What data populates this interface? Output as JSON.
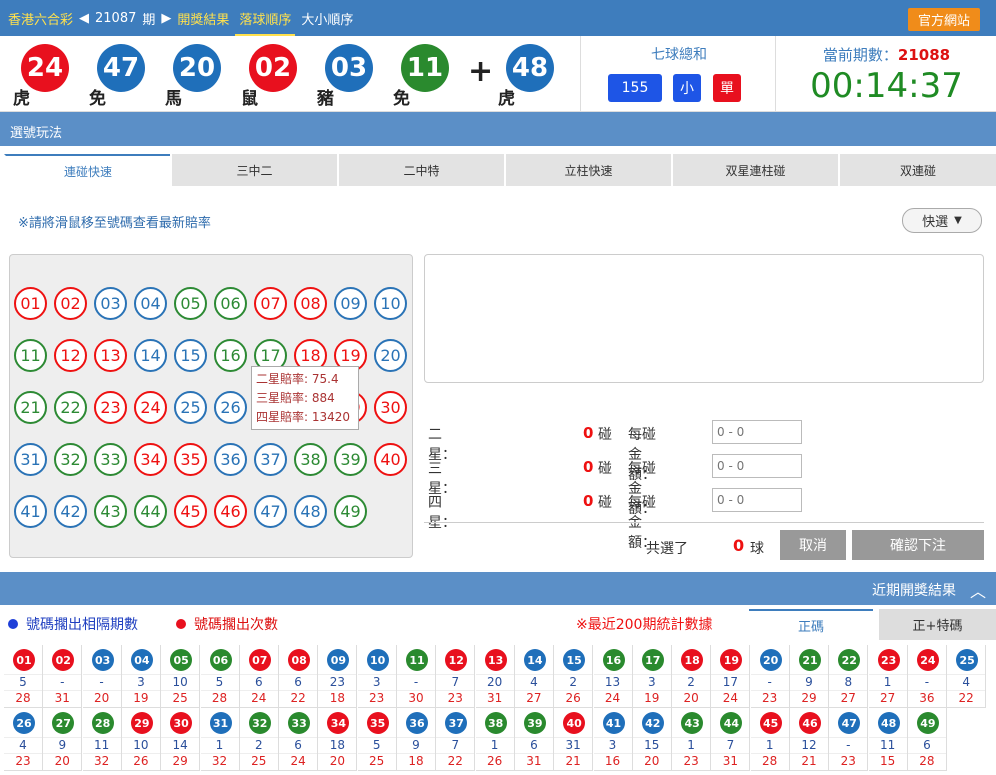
{
  "colors": {
    "red": "#e8101e",
    "blue": "#1f6fba",
    "green": "#2a8a2e",
    "accent": "#3e7dbd",
    "clock": "#1f8b24"
  },
  "topnav": {
    "lottery": "香港六合彩",
    "prev": "◀",
    "issue": "21087",
    "issue_suffix": "期",
    "next": "▶",
    "results": "開獎結果",
    "drop_order": "落球順序",
    "size_order": "大小順序",
    "official": "官方網站"
  },
  "result": {
    "balls": [
      {
        "num": "24",
        "zodiac": "虎",
        "color": "red"
      },
      {
        "num": "47",
        "zodiac": "免",
        "color": "blue"
      },
      {
        "num": "20",
        "zodiac": "馬",
        "color": "blue"
      },
      {
        "num": "02",
        "zodiac": "鼠",
        "color": "red"
      },
      {
        "num": "03",
        "zodiac": "豬",
        "color": "blue"
      },
      {
        "num": "11",
        "zodiac": "免",
        "color": "green"
      }
    ],
    "plus": "+",
    "special": {
      "num": "48",
      "zodiac": "虎",
      "color": "blue"
    }
  },
  "sum": {
    "title": "七球總和",
    "value": "155",
    "size": "小",
    "parity": "單"
  },
  "current": {
    "label": "當前期數：",
    "issue": "21088",
    "timer": "00:14:37"
  },
  "section_title": "選號玩法",
  "tabs": [
    "連碰快速",
    "三中二",
    "二中特",
    "立柱快速",
    "双星連柱碰",
    "双連碰"
  ],
  "note": "※請將滑鼠移至號碼查看最新賠率",
  "speed": "快選",
  "speed_icon": "chevron-down-icon",
  "numbers": [
    {
      "n": "01",
      "c": "red"
    },
    {
      "n": "02",
      "c": "red"
    },
    {
      "n": "03",
      "c": "blue"
    },
    {
      "n": "04",
      "c": "blue"
    },
    {
      "n": "05",
      "c": "green"
    },
    {
      "n": "06",
      "c": "green"
    },
    {
      "n": "07",
      "c": "red"
    },
    {
      "n": "08",
      "c": "red"
    },
    {
      "n": "09",
      "c": "blue"
    },
    {
      "n": "10",
      "c": "blue"
    },
    {
      "n": "11",
      "c": "green"
    },
    {
      "n": "12",
      "c": "red"
    },
    {
      "n": "13",
      "c": "red"
    },
    {
      "n": "14",
      "c": "blue"
    },
    {
      "n": "15",
      "c": "blue"
    },
    {
      "n": "16",
      "c": "green"
    },
    {
      "n": "17",
      "c": "green"
    },
    {
      "n": "18",
      "c": "red"
    },
    {
      "n": "19",
      "c": "red"
    },
    {
      "n": "20",
      "c": "blue"
    },
    {
      "n": "21",
      "c": "green"
    },
    {
      "n": "22",
      "c": "green"
    },
    {
      "n": "23",
      "c": "red"
    },
    {
      "n": "24",
      "c": "red"
    },
    {
      "n": "25",
      "c": "blue"
    },
    {
      "n": "26",
      "c": "blue"
    },
    {
      "n": "27",
      "c": "green"
    },
    {
      "n": "28",
      "c": "green"
    },
    {
      "n": "29",
      "c": "red"
    },
    {
      "n": "30",
      "c": "red"
    },
    {
      "n": "31",
      "c": "blue"
    },
    {
      "n": "32",
      "c": "green"
    },
    {
      "n": "33",
      "c": "green"
    },
    {
      "n": "34",
      "c": "red"
    },
    {
      "n": "35",
      "c": "red"
    },
    {
      "n": "36",
      "c": "blue"
    },
    {
      "n": "37",
      "c": "blue"
    },
    {
      "n": "38",
      "c": "green"
    },
    {
      "n": "39",
      "c": "green"
    },
    {
      "n": "40",
      "c": "red"
    },
    {
      "n": "41",
      "c": "blue"
    },
    {
      "n": "42",
      "c": "blue"
    },
    {
      "n": "43",
      "c": "green"
    },
    {
      "n": "44",
      "c": "green"
    },
    {
      "n": "45",
      "c": "red"
    },
    {
      "n": "46",
      "c": "red"
    },
    {
      "n": "47",
      "c": "blue"
    },
    {
      "n": "48",
      "c": "blue"
    },
    {
      "n": "49",
      "c": "green"
    }
  ],
  "tooltip": [
    "二星賠率: 75.4",
    "三星賠率: 884",
    "四星賠率: 13420"
  ],
  "bet_rows": [
    {
      "label": "二星：",
      "count": "0",
      "unit": "碰",
      "money_label": "每碰金額：",
      "placeholder": "0 - 0"
    },
    {
      "label": "三星：",
      "count": "0",
      "unit": "碰",
      "money_label": "每碰金額：",
      "placeholder": "0 - 0"
    },
    {
      "label": "四星：",
      "count": "0",
      "unit": "碰",
      "money_label": "每碰金額：",
      "placeholder": "0 - 0"
    }
  ],
  "total": {
    "label": "共選了",
    "count": "0",
    "unit": "球"
  },
  "buttons": {
    "cancel": "取消",
    "confirm": "確認下注"
  },
  "recent": {
    "title": "近期開獎結果",
    "toggle": "⌃"
  },
  "legend": {
    "blue": "號碼擱出相隔期數",
    "red": "號碼擱出次數",
    "stat": "※最近200期統計數據"
  },
  "stat_tabs": [
    "正碼",
    "正+特碼"
  ],
  "stats": [
    {
      "n": "01",
      "c": "red",
      "a": "5",
      "b": "28"
    },
    {
      "n": "02",
      "c": "red",
      "a": "-",
      "b": "31"
    },
    {
      "n": "03",
      "c": "blue",
      "a": "-",
      "b": "20"
    },
    {
      "n": "04",
      "c": "blue",
      "a": "3",
      "b": "19"
    },
    {
      "n": "05",
      "c": "green",
      "a": "10",
      "b": "25"
    },
    {
      "n": "06",
      "c": "green",
      "a": "5",
      "b": "28"
    },
    {
      "n": "07",
      "c": "red",
      "a": "6",
      "b": "24"
    },
    {
      "n": "08",
      "c": "red",
      "a": "6",
      "b": "22"
    },
    {
      "n": "09",
      "c": "blue",
      "a": "23",
      "b": "18"
    },
    {
      "n": "10",
      "c": "blue",
      "a": "3",
      "b": "23"
    },
    {
      "n": "11",
      "c": "green",
      "a": "-",
      "b": "30"
    },
    {
      "n": "12",
      "c": "red",
      "a": "7",
      "b": "23"
    },
    {
      "n": "13",
      "c": "red",
      "a": "20",
      "b": "31"
    },
    {
      "n": "14",
      "c": "blue",
      "a": "4",
      "b": "27"
    },
    {
      "n": "15",
      "c": "blue",
      "a": "2",
      "b": "26"
    },
    {
      "n": "16",
      "c": "green",
      "a": "13",
      "b": "24"
    },
    {
      "n": "17",
      "c": "green",
      "a": "3",
      "b": "19"
    },
    {
      "n": "18",
      "c": "red",
      "a": "2",
      "b": "20"
    },
    {
      "n": "19",
      "c": "red",
      "a": "17",
      "b": "24"
    },
    {
      "n": "20",
      "c": "blue",
      "a": "-",
      "b": "23"
    },
    {
      "n": "21",
      "c": "green",
      "a": "9",
      "b": "29"
    },
    {
      "n": "22",
      "c": "green",
      "a": "8",
      "b": "27"
    },
    {
      "n": "23",
      "c": "red",
      "a": "1",
      "b": "27"
    },
    {
      "n": "24",
      "c": "red",
      "a": "-",
      "b": "36"
    },
    {
      "n": "25",
      "c": "blue",
      "a": "4",
      "b": "22"
    },
    {
      "n": "26",
      "c": "blue",
      "a": "4",
      "b": "23"
    },
    {
      "n": "27",
      "c": "green",
      "a": "9",
      "b": "20"
    },
    {
      "n": "28",
      "c": "green",
      "a": "11",
      "b": "32"
    },
    {
      "n": "29",
      "c": "red",
      "a": "10",
      "b": "26"
    },
    {
      "n": "30",
      "c": "red",
      "a": "14",
      "b": "29"
    },
    {
      "n": "31",
      "c": "blue",
      "a": "1",
      "b": "32"
    },
    {
      "n": "32",
      "c": "green",
      "a": "2",
      "b": "25"
    },
    {
      "n": "33",
      "c": "green",
      "a": "6",
      "b": "24"
    },
    {
      "n": "34",
      "c": "red",
      "a": "18",
      "b": "20"
    },
    {
      "n": "35",
      "c": "red",
      "a": "5",
      "b": "25"
    },
    {
      "n": "36",
      "c": "blue",
      "a": "9",
      "b": "18"
    },
    {
      "n": "37",
      "c": "blue",
      "a": "7",
      "b": "22"
    },
    {
      "n": "38",
      "c": "green",
      "a": "1",
      "b": "26"
    },
    {
      "n": "39",
      "c": "green",
      "a": "6",
      "b": "31"
    },
    {
      "n": "40",
      "c": "red",
      "a": "31",
      "b": "21"
    },
    {
      "n": "41",
      "c": "blue",
      "a": "3",
      "b": "16"
    },
    {
      "n": "42",
      "c": "blue",
      "a": "15",
      "b": "20"
    },
    {
      "n": "43",
      "c": "green",
      "a": "1",
      "b": "23"
    },
    {
      "n": "44",
      "c": "green",
      "a": "7",
      "b": "31"
    },
    {
      "n": "45",
      "c": "red",
      "a": "1",
      "b": "28"
    },
    {
      "n": "46",
      "c": "red",
      "a": "12",
      "b": "21"
    },
    {
      "n": "47",
      "c": "blue",
      "a": "-",
      "b": "23"
    },
    {
      "n": "48",
      "c": "blue",
      "a": "11",
      "b": "15"
    },
    {
      "n": "49",
      "c": "green",
      "a": "6",
      "b": "28"
    }
  ]
}
